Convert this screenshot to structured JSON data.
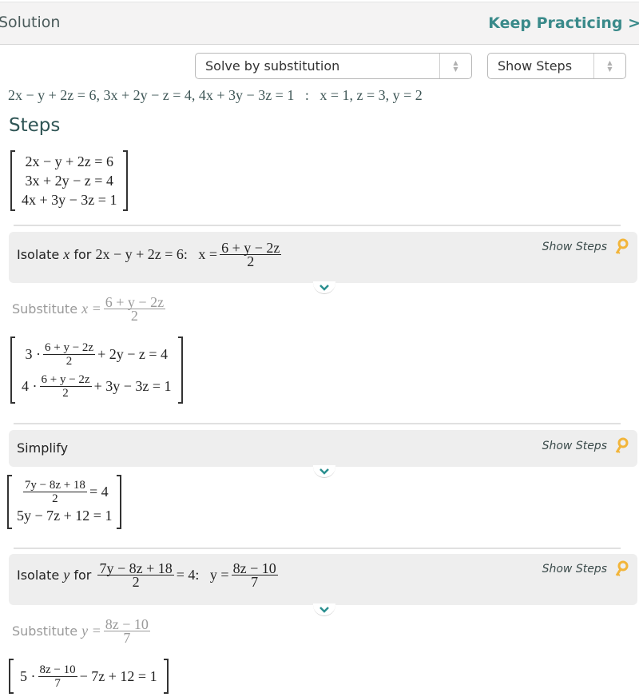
{
  "header": {
    "title": "Solution",
    "keep_practicing": "Keep Practicing >"
  },
  "controls": {
    "method_select": {
      "value": "Solve by substitution"
    },
    "steps_select": {
      "value": "Show Steps"
    }
  },
  "answer": {
    "system": "2x − y + 2z = 6, 3x + 2y − z = 4, 4x + 3y − 3z = 1",
    "separator": ":",
    "solution": "x = 1, z = 3, y = 2"
  },
  "steps_heading": "Steps",
  "initial_system": [
    "2x − y + 2z = 6",
    "3x + 2y − z = 4",
    "4x + 3y − 3z = 1"
  ],
  "show_steps_label": "Show Steps",
  "step1": {
    "prefix": "Isolate ",
    "var": "x",
    "for": " for ",
    "equation": "2x − y + 2z = 6:",
    "result_lhs": "x =",
    "result_num": "6 + y − 2z",
    "result_den": "2"
  },
  "substitute1": {
    "label": "Substitute ",
    "lhs": "x =",
    "num": "6 + y − 2z",
    "den": "2"
  },
  "system2": [
    {
      "coef": "3 ·",
      "num": "6 + y − 2z",
      "den": "2",
      "rest": "+ 2y − z = 4"
    },
    {
      "coef": "4 ·",
      "num": "6 + y − 2z",
      "den": "2",
      "rest": "+ 3y − 3z = 1"
    }
  ],
  "step2": {
    "label": "Simplify"
  },
  "system3": [
    {
      "num": "7y − 8z + 18",
      "den": "2",
      "rest": "= 4"
    },
    {
      "text": "5y − 7z + 12 = 1"
    }
  ],
  "step3": {
    "prefix": "Isolate ",
    "var": "y",
    "for": " for ",
    "eq_num": "7y − 8z + 18",
    "eq_den": "2",
    "eq_rest": "= 4:",
    "result_lhs": "y =",
    "result_num": "8z − 10",
    "result_den": "7"
  },
  "substitute2": {
    "label": "Substitute ",
    "lhs": "y =",
    "num": "8z − 10",
    "den": "7"
  },
  "system4": [
    {
      "coef": "5 ·",
      "num": "8z − 10",
      "den": "7",
      "rest": "− 7z + 12 = 1"
    }
  ],
  "colors": {
    "accent_teal": "#3a8a8a",
    "key_icon": "#f2b53a",
    "chevron": "#2a8f8f"
  }
}
